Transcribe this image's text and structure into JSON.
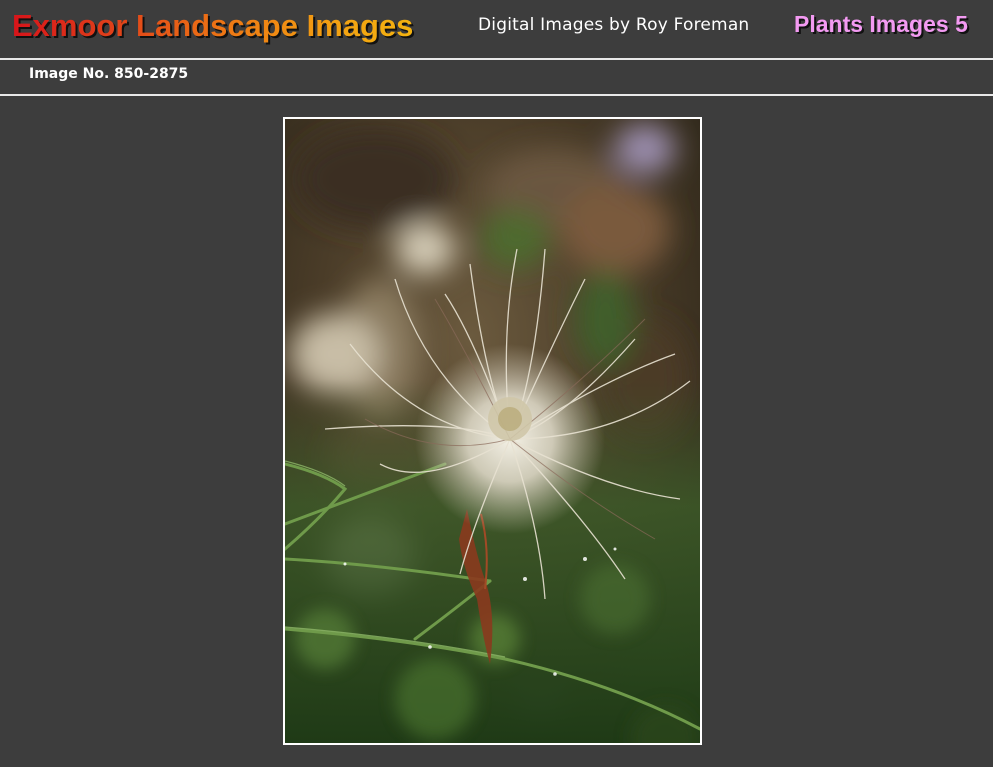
{
  "header": {
    "site_title": "Exmoor Landscape Images",
    "site_subtitle": "Digital Images by Roy Foreman",
    "section_title": "Plants Images 5"
  },
  "image_bar": {
    "image_number": "Image No. 850-2875"
  },
  "photo": {
    "subject": "pasqueflower-seedhead-photo"
  },
  "colors": {
    "background": "#3d3d3d",
    "rule": "#e8e8e8",
    "subtitle_text": "#ffffff",
    "section_title": "#f39af2",
    "title_gradient_start": "#d7141a",
    "title_gradient_end": "#f4b310"
  }
}
